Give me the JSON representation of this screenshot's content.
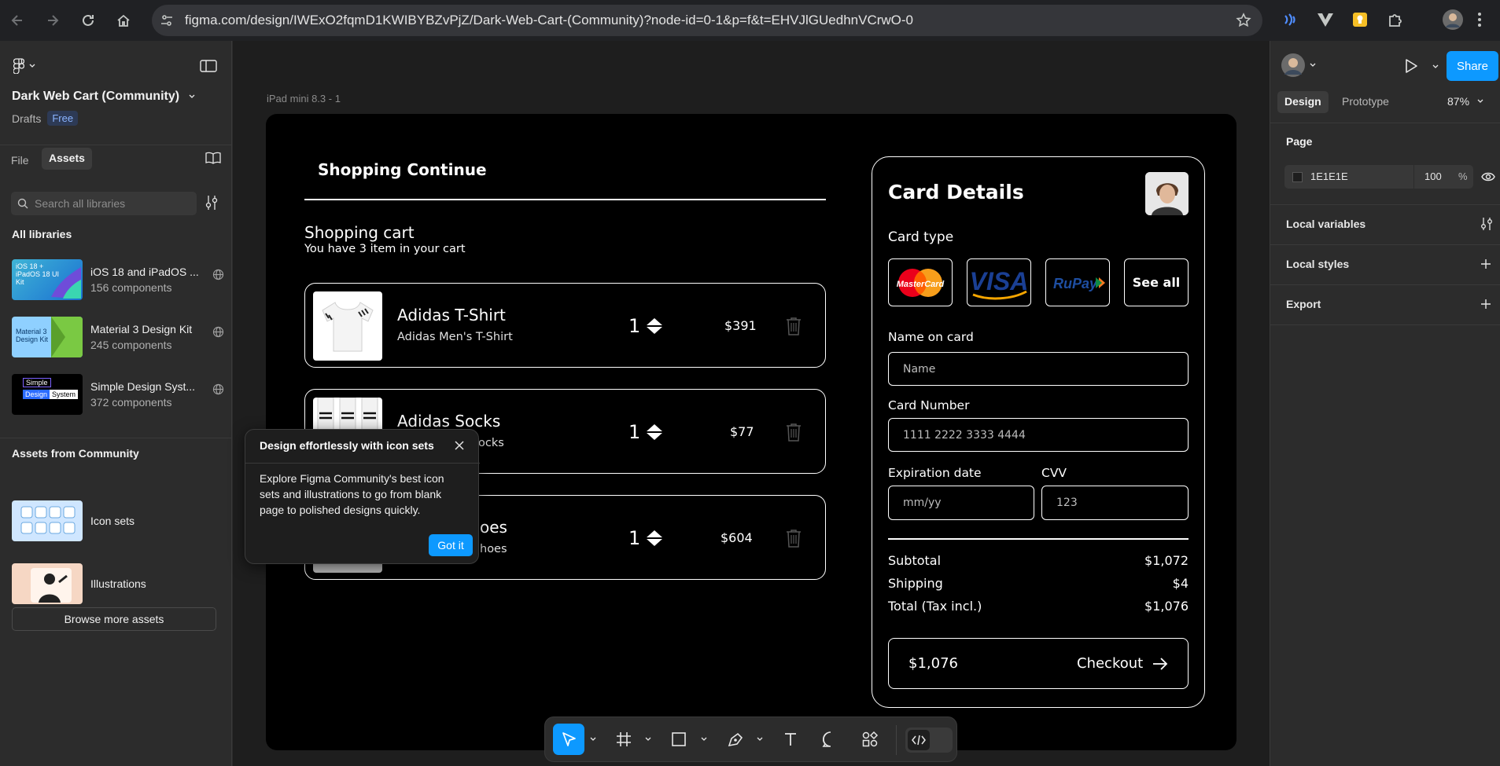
{
  "browser": {
    "url": "figma.com/design/IWExO2fqmD1KWIBYBZvPjZ/Dark-Web-Cart-(Community)?node-id=0-1&p=f&t=EHVJlGUedhnVCrwO-0"
  },
  "left_panel": {
    "file_name": "Dark Web Cart (Community)",
    "location": "Drafts",
    "plan_badge": "Free",
    "tabs": [
      "File",
      "Assets"
    ],
    "search_placeholder": "Search all libraries",
    "all_libraries_heading": "All libraries",
    "libraries": [
      {
        "name": "iOS 18 and iPadOS ...",
        "count": "156 components",
        "thumb_text": "iOS 18 + iPadOS 18 UI Kit"
      },
      {
        "name": "Material 3 Design Kit",
        "count": "245 components",
        "thumb_text": "Material 3 Design Kit"
      },
      {
        "name": "Simple Design Syst...",
        "count": "372 components",
        "thumb_text_1": "Simple",
        "thumb_text_2": "Design",
        "thumb_text_3": "System"
      }
    ],
    "community_heading": "Assets from Community",
    "community": [
      {
        "name": "Icon sets"
      },
      {
        "name": "Illustrations"
      }
    ],
    "browse_button": "Browse more assets"
  },
  "popover": {
    "title": "Design effortlessly with icon sets",
    "body": "Explore Figma Community's best icon sets and illustrations to go from blank page to polished designs quickly.",
    "button": "Got it"
  },
  "canvas": {
    "frame_label": "iPad mini 8.3 - 1"
  },
  "design": {
    "shopping_continue": "Shopping Continue",
    "cart_title": "Shopping cart",
    "cart_subtitle": "You have 3 item in your cart",
    "items": [
      {
        "title": "Adidas T-Shirt",
        "subtitle": "Adidas Men's T-Shirt",
        "qty": "1",
        "price": "$391"
      },
      {
        "title": "Adidas Socks",
        "subtitle": "ocks",
        "qty": "1",
        "price": "$77"
      },
      {
        "title": "oes",
        "subtitle": "hoes",
        "qty": "1",
        "price": "$604"
      }
    ],
    "card": {
      "title": "Card Details",
      "card_type_label": "Card type",
      "card_types": [
        "MasterCard",
        "VISA",
        "RuPay",
        "See all"
      ],
      "name_label": "Name on card",
      "name_placeholder": "Name",
      "number_label": "Card Number",
      "number_placeholder": "1111 2222 3333 4444",
      "exp_label": "Expiration date",
      "exp_placeholder": "mm/yy",
      "cvv_label": "CVV",
      "cvv_placeholder": "123",
      "subtotal_label": "Subtotal",
      "subtotal_value": "$1,072",
      "shipping_label": "Shipping",
      "shipping_value": "$4",
      "total_label": "Total (Tax incl.)",
      "total_value": "$1,076",
      "checkout_amount": "$1,076",
      "checkout_label": "Checkout"
    }
  },
  "right_panel": {
    "share": "Share",
    "tabs": [
      "Design",
      "Prototype"
    ],
    "zoom": "87%",
    "page_heading": "Page",
    "page_color": "1E1E1E",
    "page_opacity": "100",
    "page_opacity_unit": "%",
    "sections": [
      "Local variables",
      "Local styles",
      "Export"
    ]
  },
  "help": "?"
}
